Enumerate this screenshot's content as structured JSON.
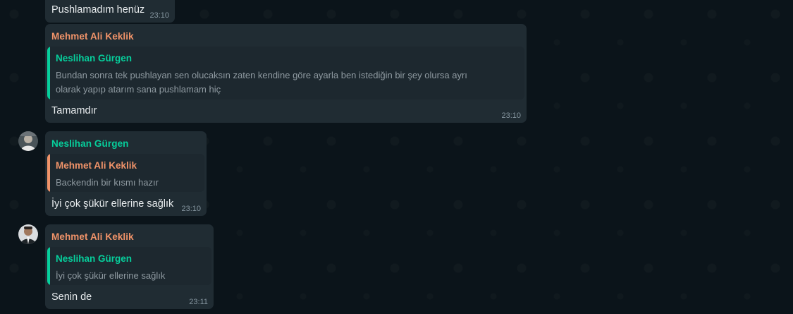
{
  "messages": [
    {
      "text": "Pushlamadım henüz",
      "time": "23:10"
    },
    {
      "sender": "Mehmet Ali Keklik",
      "quote": {
        "name": "Neslihan Gürgen",
        "text": "Bundan sonra tek pushlayan sen olucaksın zaten kendine göre ayarla ben istediğin bir şey olursa ayrı olarak yapıp atarım sana pushlamam hiç"
      },
      "text": "Tamamdır",
      "time": "23:10"
    },
    {
      "sender": "Neslihan Gürgen",
      "avatar_icon": "avatar-photo",
      "quote": {
        "name": "Mehmet Ali Keklik",
        "text": "Backendin bir kısmı hazır"
      },
      "text": "İyi çok şükür ellerine sağlık",
      "time": "23:10"
    },
    {
      "sender": "Mehmet Ali Keklik",
      "avatar_icon": "avatar-photo",
      "quote": {
        "name": "Neslihan Gürgen",
        "text": "İyi çok şükür ellerine sağlık"
      },
      "text": "Senin de",
      "time": "23:11"
    }
  ],
  "colors": {
    "background": "#0b141a",
    "bubble": "#202c33",
    "quote_bg": "#1d282f",
    "mehmet_name": "#f09369",
    "neslihan_name": "#06cf9c",
    "message_text": "#e9edef",
    "time_text": "#8696a0"
  }
}
